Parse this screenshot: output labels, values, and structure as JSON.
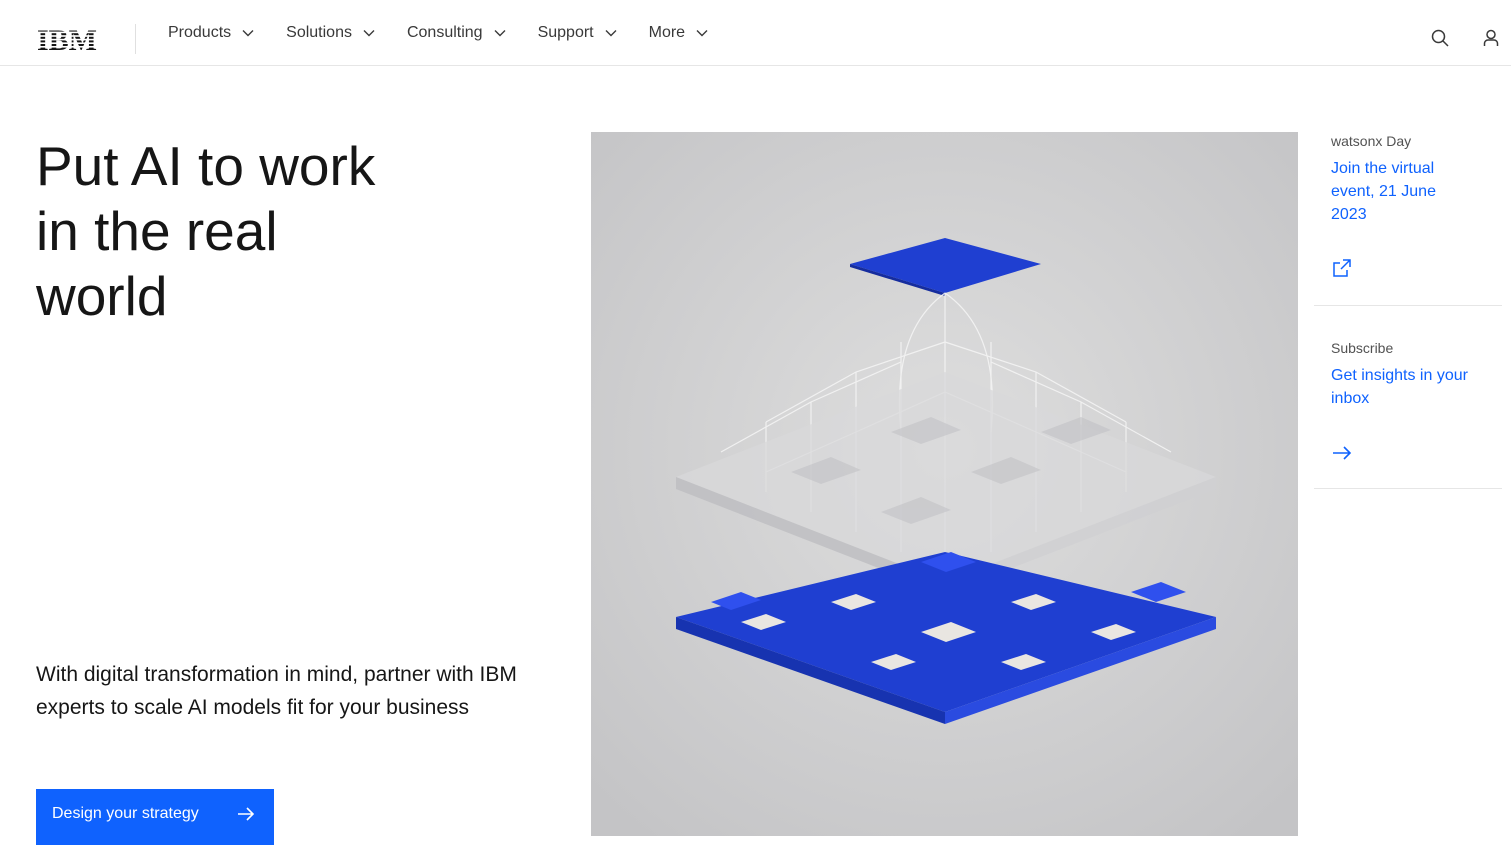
{
  "brand": {
    "logo_text": "IBM",
    "accent": "#0f62fe"
  },
  "nav": {
    "items": [
      {
        "label": "Products"
      },
      {
        "label": "Solutions"
      },
      {
        "label": "Consulting"
      },
      {
        "label": "Support"
      },
      {
        "label": "More"
      }
    ],
    "icons": [
      "search-icon",
      "user-icon"
    ]
  },
  "hero": {
    "headline_lines": [
      "Put AI to work",
      "in the real",
      "world"
    ],
    "subcopy": "With digital transformation in mind, partner with IBM experts to scale AI models fit for your business",
    "cta_label": "Design your strategy"
  },
  "rail": {
    "cards": [
      {
        "eyebrow": "watsonx Day",
        "link": "Join the virtual event, 21 June 2023",
        "icon": "external-link-icon"
      },
      {
        "eyebrow": "Subscribe",
        "link": "Get insights in your inbox",
        "icon": "arrow-right-icon"
      }
    ]
  }
}
